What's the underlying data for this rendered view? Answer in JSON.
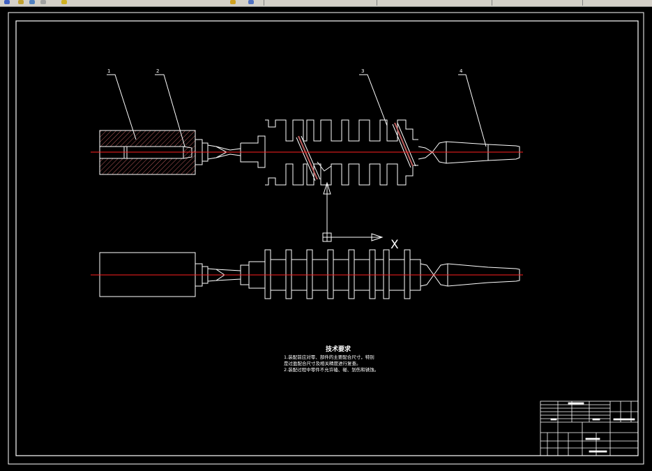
{
  "labels": {
    "part1": "1",
    "part2": "2",
    "part3": "3",
    "part4": "4",
    "axis_x": "X"
  },
  "notes": {
    "title": "技术要求",
    "line1": "1.装配前应对零、部件的主要配合尺寸，特别",
    "line2": "是过盈配合尺寸及相关精度进行复查。",
    "line3": "2.装配过程中零件不允许磕、碰、划伤和锈蚀。"
  },
  "colors": {
    "background": "#000000",
    "line": "#ffffff",
    "centerline": "#ff2020",
    "hatch": "#c06060"
  }
}
